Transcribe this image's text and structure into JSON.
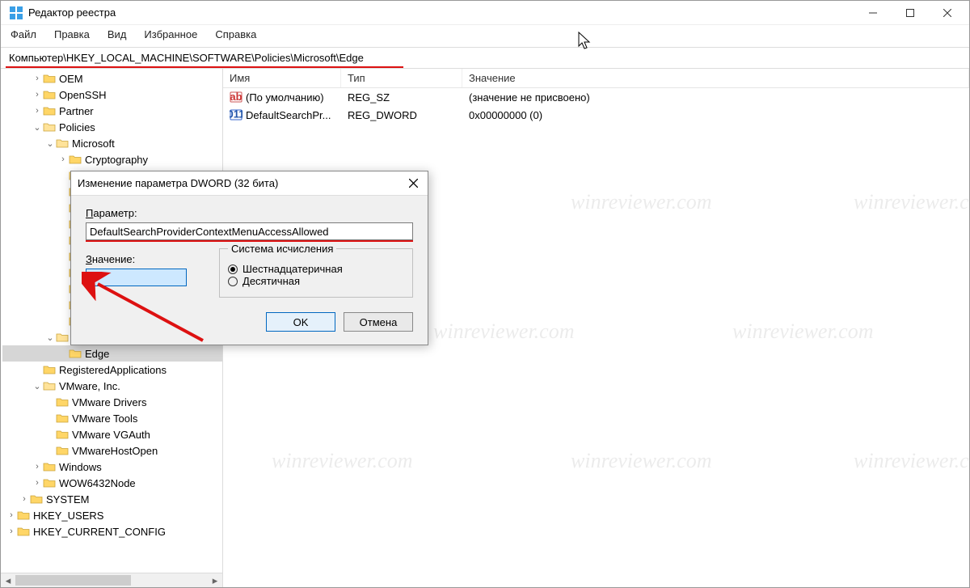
{
  "titlebar": {
    "title": "Редактор реестра"
  },
  "menu": {
    "file": "Файл",
    "edit": "Правка",
    "view": "Вид",
    "favorites": "Избранное",
    "help": "Справка"
  },
  "address": {
    "path": "Компьютер\\HKEY_LOCAL_MACHINE\\SOFTWARE\\Policies\\Microsoft\\Edge"
  },
  "tree": {
    "items": [
      {
        "indent": 2,
        "twisty": ">",
        "label": "OEM"
      },
      {
        "indent": 2,
        "twisty": ">",
        "label": "OpenSSH"
      },
      {
        "indent": 2,
        "twisty": ">",
        "label": "Partner"
      },
      {
        "indent": 2,
        "twisty": "v",
        "label": "Policies"
      },
      {
        "indent": 3,
        "twisty": "v",
        "label": "Microsoft"
      },
      {
        "indent": 4,
        "twisty": ">",
        "label": "Cryptography"
      },
      {
        "indent": 4,
        "twisty": "",
        "label": ""
      },
      {
        "indent": 4,
        "twisty": "",
        "label": ""
      },
      {
        "indent": 4,
        "twisty": "",
        "label": ""
      },
      {
        "indent": 4,
        "twisty": "",
        "label": ""
      },
      {
        "indent": 4,
        "twisty": "",
        "label": ""
      },
      {
        "indent": 4,
        "twisty": "",
        "label": ""
      },
      {
        "indent": 4,
        "twisty": "",
        "label": ""
      },
      {
        "indent": 4,
        "twisty": "",
        "label": ""
      },
      {
        "indent": 4,
        "twisty": "",
        "label": ""
      },
      {
        "indent": 4,
        "twisty": "",
        "label": ""
      },
      {
        "indent": 3,
        "twisty": "v",
        "label": ""
      },
      {
        "indent": 4,
        "twisty": "",
        "label": "Edge",
        "selected": true
      },
      {
        "indent": 2,
        "twisty": "",
        "label": "RegisteredApplications"
      },
      {
        "indent": 2,
        "twisty": "v",
        "label": "VMware, Inc."
      },
      {
        "indent": 3,
        "twisty": "",
        "label": "VMware Drivers"
      },
      {
        "indent": 3,
        "twisty": "",
        "label": "VMware Tools"
      },
      {
        "indent": 3,
        "twisty": "",
        "label": "VMware VGAuth"
      },
      {
        "indent": 3,
        "twisty": "",
        "label": "VMwareHostOpen"
      },
      {
        "indent": 2,
        "twisty": ">",
        "label": "Windows"
      },
      {
        "indent": 2,
        "twisty": ">",
        "label": "WOW6432Node"
      },
      {
        "indent": 1,
        "twisty": ">",
        "label": "SYSTEM"
      },
      {
        "indent": 0,
        "twisty": ">",
        "label": "HKEY_USERS"
      },
      {
        "indent": 0,
        "twisty": ">",
        "label": "HKEY_CURRENT_CONFIG"
      }
    ]
  },
  "list": {
    "columns": {
      "name": "Имя",
      "type": "Тип",
      "data": "Значение"
    },
    "rows": [
      {
        "icon": "sz",
        "name": "(По умолчанию)",
        "type": "REG_SZ",
        "data": "(значение не присвоено)"
      },
      {
        "icon": "dword",
        "name": "DefaultSearchPr...",
        "type": "REG_DWORD",
        "data": "0x00000000 (0)"
      }
    ]
  },
  "dialog": {
    "title": "Изменение параметра DWORD (32 бита)",
    "name_label": "Параметр:",
    "name_value": "DefaultSearchProviderContextMenuAccessAllowed",
    "value_label": "Значение:",
    "value_value": "0",
    "base_group_label": "Система исчисления",
    "radio_hex": "Шестнадцатеричная",
    "radio_dec": "Десятичная",
    "base_selected": "hex",
    "ok": "OK",
    "cancel": "Отмена"
  },
  "watermark_text": "winreviewer.com"
}
